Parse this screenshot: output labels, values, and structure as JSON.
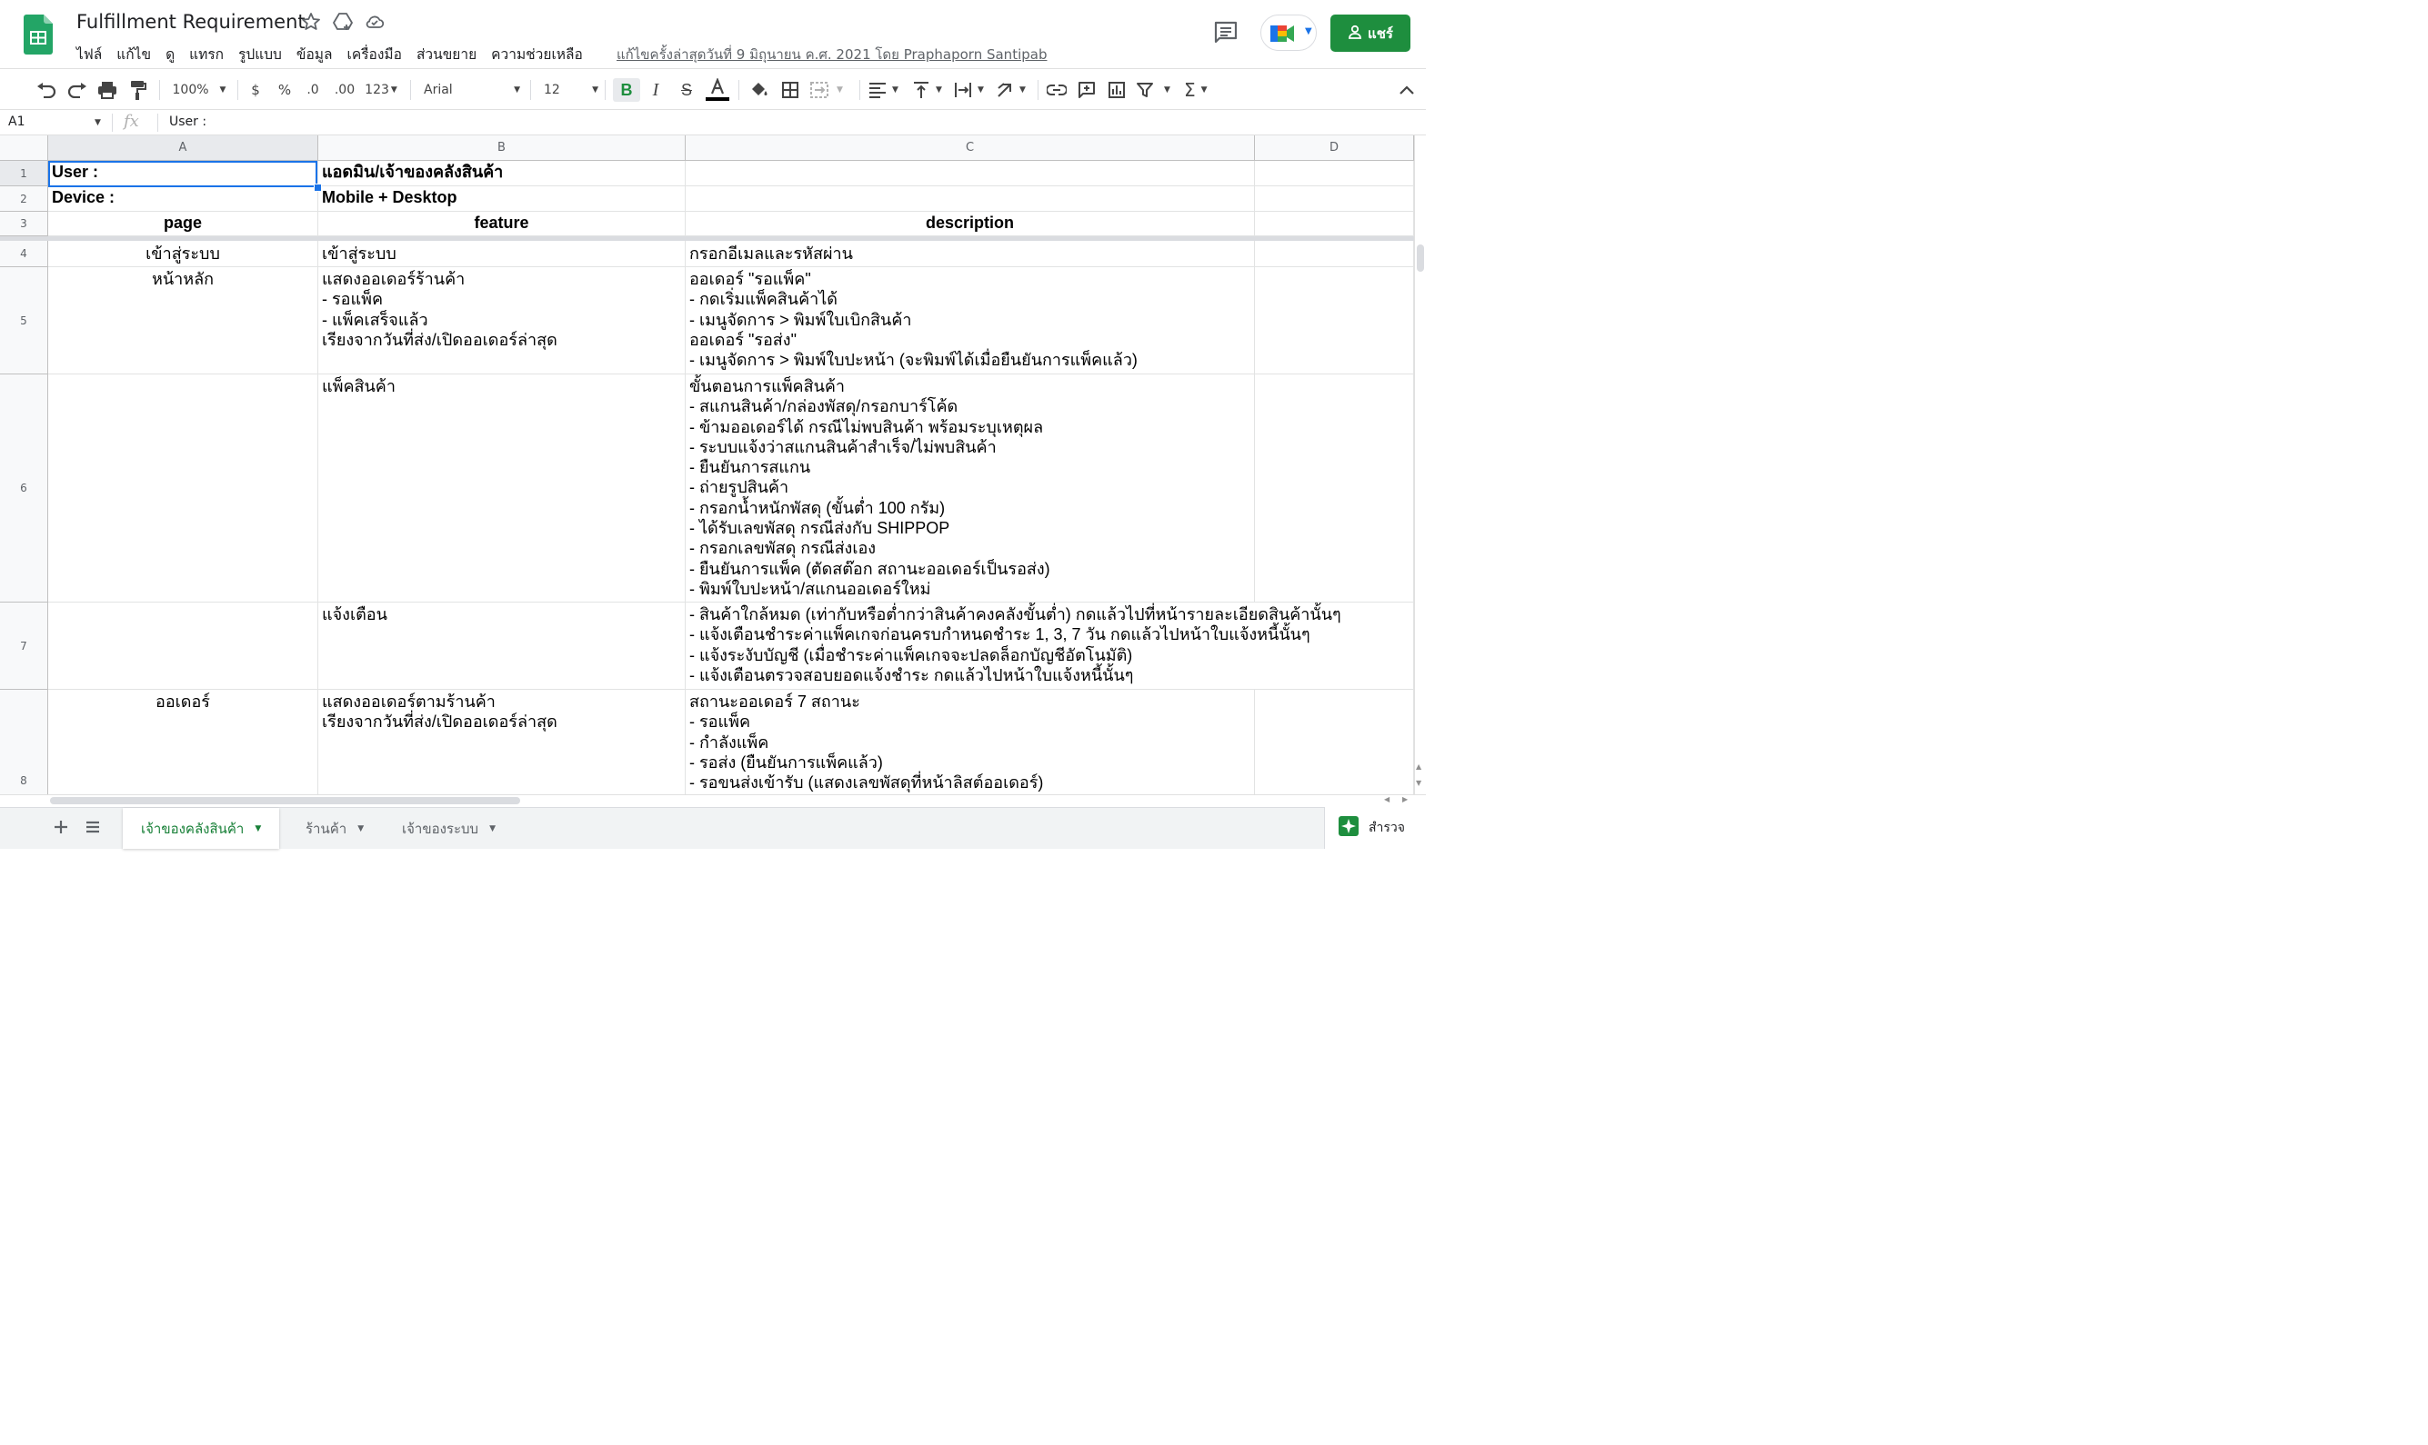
{
  "app": {
    "title": "Fulfillment Requirement",
    "menu": [
      "ไฟล์",
      "แก้ไข",
      "ดู",
      "แทรก",
      "รูปแบบ",
      "ข้อมูล",
      "เครื่องมือ",
      "ส่วนขยาย",
      "ความช่วยเหลือ"
    ],
    "last_edit": "แก้ไขครั้งล่าสุดวันที่ 9 มิถุนายน ค.ศ. 2021 โดย Praphaporn Santipab",
    "share_label": "แชร์",
    "brand_color": "#1e8e3e"
  },
  "toolbar": {
    "zoom": "100%",
    "currency": "$",
    "percent": "%",
    "decrease_decimal": ".0",
    "increase_decimal": ".00",
    "number_format": "123",
    "font": "Arial",
    "font_size": "12"
  },
  "formula_bar": {
    "cell_ref": "A1",
    "fx": "fx",
    "value": "User :"
  },
  "columns": [
    "A",
    "B",
    "C",
    "D"
  ],
  "rows": [
    {
      "num": "1",
      "a": "User :",
      "b": "แอดมิน/เจ้าของคลังสินค้า",
      "c": ""
    },
    {
      "num": "2",
      "a": "Device :",
      "b": "Mobile + Desktop",
      "c": ""
    },
    {
      "num": "3",
      "a": "page",
      "b": "feature",
      "c": "description"
    },
    {
      "num": "4",
      "a": "เข้าสู่ระบบ",
      "b": "เข้าสู่ระบบ",
      "c": "กรอกอีเมลและรหัสผ่าน"
    },
    {
      "num": "5",
      "a": "หน้าหลัก",
      "b": "แสดงออเดอร์ร้านค้า\n- รอแพ็ค\n- แพ็คเสร็จแล้ว\nเรียงจากวันที่ส่ง/เปิดออเดอร์ล่าสุด",
      "c": "ออเดอร์ \"รอแพ็ค\"\n- กดเริ่มแพ็คสินค้าได้\n- เมนูจัดการ > พิมพ์ใบเบิกสินค้า\nออเดอร์ \"รอส่ง\"\n- เมนูจัดการ > พิมพ์ใบปะหน้า (จะพิมพ์ได้เมื่อยืนยันการแพ็คแล้ว)"
    },
    {
      "num": "6",
      "a": "",
      "b": "แพ็คสินค้า",
      "c": "ขั้นตอนการแพ็คสินค้า\n- สแกนสินค้า/กล่องพัสดุ/กรอกบาร์โค้ด\n- ข้ามออเดอร์ได้ กรณีไม่พบสินค้า พร้อมระบุเหตุผล\n- ระบบแจ้งว่าสแกนสินค้าสำเร็จ/ไม่พบสินค้า\n- ยืนยันการสแกน\n- ถ่ายรูปสินค้า\n- กรอกน้ำหนักพัสดุ (ขั้นต่ำ 100 กรัม)\n- ได้รับเลขพัสดุ กรณีส่งกับ SHIPPOP\n- กรอกเลขพัสดุ กรณีส่งเอง\n- ยืนยันการแพ็ค (ตัดสต๊อก สถานะออเดอร์เป็นรอส่ง)\n- พิมพ์ใบปะหน้า/สแกนออเดอร์ใหม่"
    },
    {
      "num": "7",
      "a": "",
      "b": "แจ้งเตือน",
      "c": "- สินค้าใกล้หมด (เท่ากับหรือต่ำกว่าสินค้าคงคลังขั้นต่ำ) กดแล้วไปที่หน้ารายละเอียดสินค้านั้นๆ\n- แจ้งเตือนชำระค่าแพ็คเกจก่อนครบกำหนดชำระ 1, 3, 7 วัน กดแล้วไปหน้าใบแจ้งหนี้นั้นๆ\n- แจ้งระงับบัญชี (เมื่อชำระค่าแพ็คเกจจะปลดล็อกบัญชีอัตโนมัติ)\n- แจ้งเตือนตรวจสอบยอดแจ้งชำระ กดแล้วไปหน้าใบแจ้งหนี้นั้นๆ"
    },
    {
      "num": "8",
      "a": "ออเดอร์",
      "b": "แสดงออเดอร์ตามร้านค้า\nเรียงจากวันที่ส่ง/เปิดออเดอร์ล่าสุด",
      "c": "สถานะออเดอร์ 7 สถานะ\n- รอแพ็ค\n- กำลังแพ็ค\n- รอส่ง (ยืนยันการแพ็คแล้ว)\n- รอขนส่งเข้ารับ (แสดงเลขพัสดุที่หน้าลิสต์ออเดอร์)"
    }
  ],
  "sheet_tabs": [
    "เจ้าของคลังสินค้า",
    "ร้านค้า",
    "เจ้าของระบบ"
  ],
  "explore_label": "สำรวจ"
}
